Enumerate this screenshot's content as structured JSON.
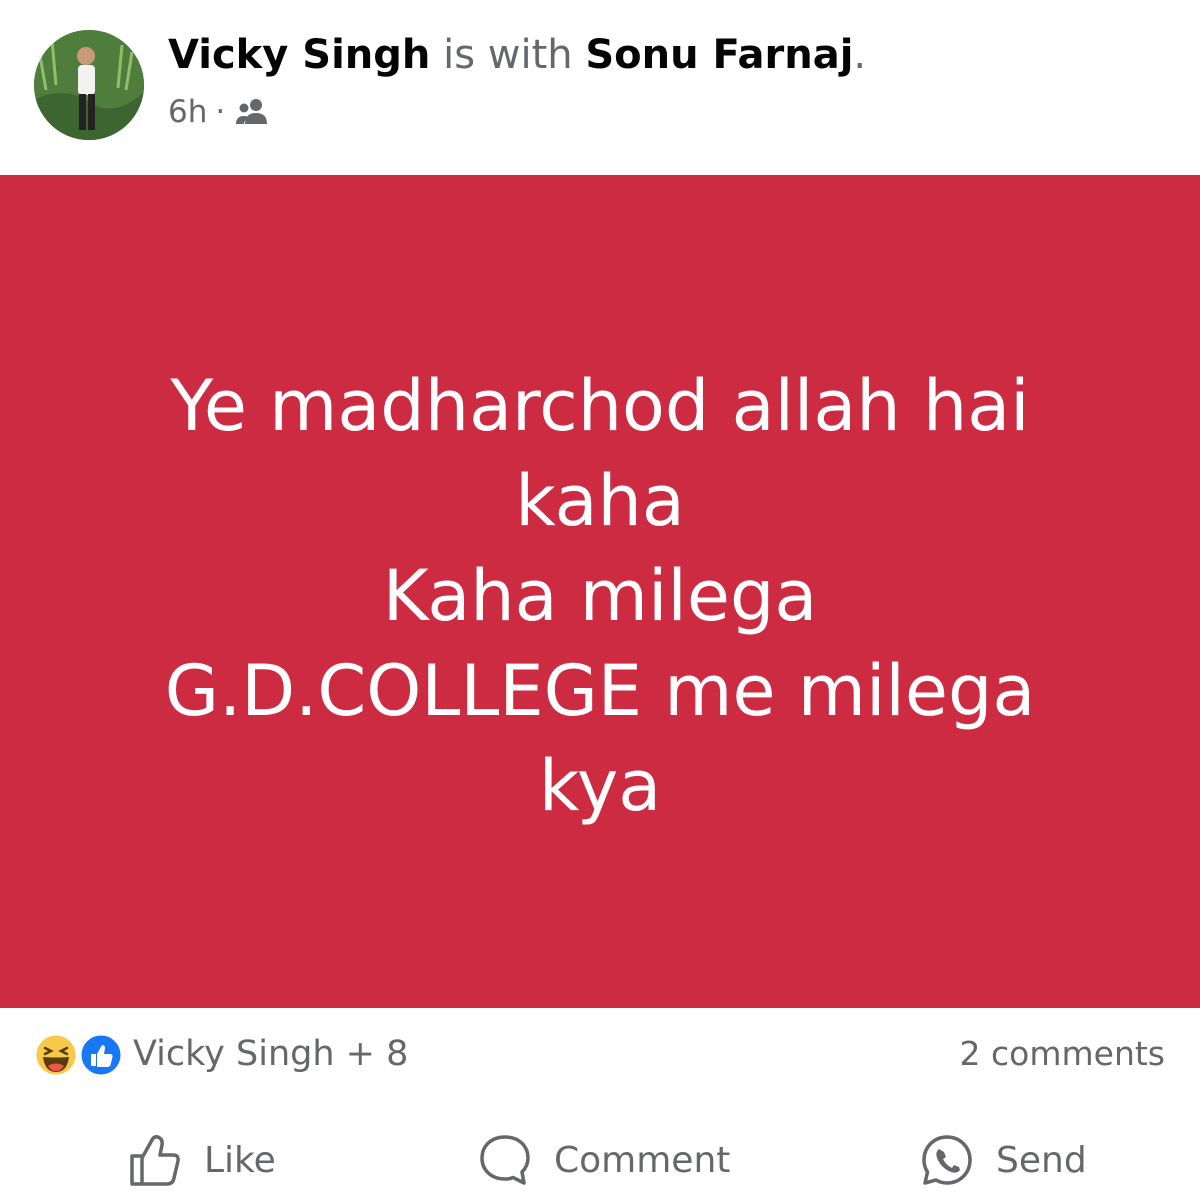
{
  "post": {
    "author": "Vicky Singh",
    "connector": "is with",
    "tagged": "Sonu Farnaj",
    "period": ".",
    "time": "6h",
    "separator": "·",
    "audience_icon": "friends-icon",
    "background_color": "#cd2b41",
    "text_color": "#ffffff",
    "lines": [
      "Ye madharchod allah hai",
      "kaha",
      "Kaha milega",
      "G.D.COLLEGE me milega",
      "kya"
    ]
  },
  "reactions": {
    "icons": [
      "haha-icon",
      "like-icon"
    ],
    "names": "Vicky Singh + 8",
    "comments": "2 comments"
  },
  "actions": {
    "like": "Like",
    "comment": "Comment",
    "send": "Send"
  }
}
